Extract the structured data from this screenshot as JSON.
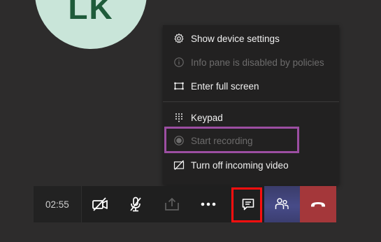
{
  "avatar": {
    "initials": "LK",
    "bg_color": "#c9e5d9",
    "text_color": "#1e5b3a"
  },
  "menu": {
    "items": [
      {
        "label": "Show device settings",
        "icon": "gear-icon",
        "enabled": true
      },
      {
        "label": "Info pane is disabled by policies",
        "icon": "info-icon",
        "enabled": false
      },
      {
        "label": "Enter full screen",
        "icon": "fullscreen-icon",
        "enabled": true
      },
      {
        "label": "Keypad",
        "icon": "keypad-icon",
        "enabled": true
      },
      {
        "label": "Start recording",
        "icon": "record-icon",
        "enabled": false
      },
      {
        "label": "Turn off incoming video",
        "icon": "video-off-icon",
        "enabled": true
      }
    ]
  },
  "toolbar": {
    "timer": "02:55",
    "buttons": [
      {
        "name": "camera-off-button",
        "icon": "camera-off-icon"
      },
      {
        "name": "mic-off-button",
        "icon": "mic-off-icon"
      },
      {
        "name": "share-button",
        "icon": "share-tray-icon"
      },
      {
        "name": "more-actions-button",
        "icon": "more-icon"
      },
      {
        "name": "chat-button",
        "icon": "chat-icon"
      },
      {
        "name": "participants-button",
        "icon": "people-icon"
      },
      {
        "name": "hang-up-button",
        "icon": "phone-hangup-icon"
      }
    ]
  },
  "colors": {
    "background": "#2d2c2c",
    "menu_bg": "#222121",
    "highlight_purple": "#9c4ea2",
    "highlight_red": "#ff0f0f",
    "hangup_bg": "#a4373a",
    "participants_bg": "#474b88"
  }
}
